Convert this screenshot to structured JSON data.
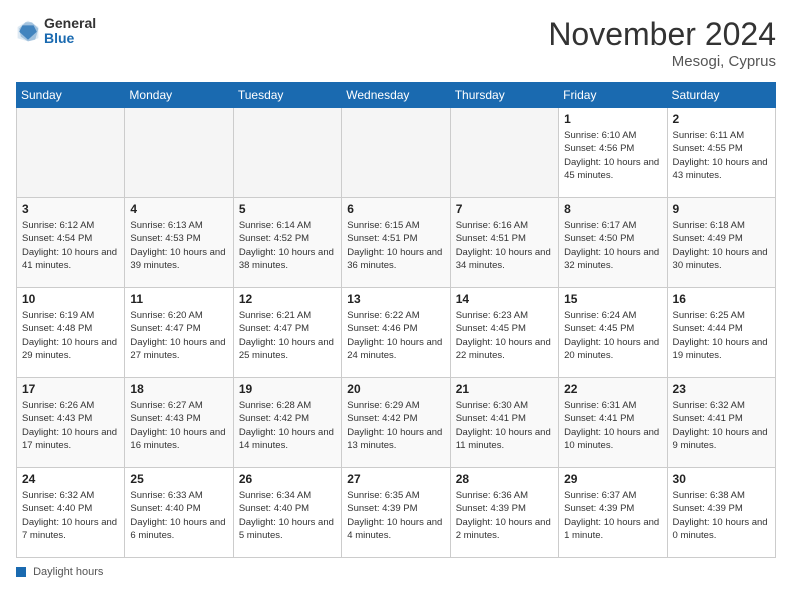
{
  "header": {
    "logo_general": "General",
    "logo_blue": "Blue",
    "month_title": "November 2024",
    "location": "Mesogi, Cyprus"
  },
  "columns": [
    "Sunday",
    "Monday",
    "Tuesday",
    "Wednesday",
    "Thursday",
    "Friday",
    "Saturday"
  ],
  "weeks": [
    [
      {
        "day": "",
        "info": ""
      },
      {
        "day": "",
        "info": ""
      },
      {
        "day": "",
        "info": ""
      },
      {
        "day": "",
        "info": ""
      },
      {
        "day": "",
        "info": ""
      },
      {
        "day": "1",
        "info": "Sunrise: 6:10 AM\nSunset: 4:56 PM\nDaylight: 10 hours and 45 minutes."
      },
      {
        "day": "2",
        "info": "Sunrise: 6:11 AM\nSunset: 4:55 PM\nDaylight: 10 hours and 43 minutes."
      }
    ],
    [
      {
        "day": "3",
        "info": "Sunrise: 6:12 AM\nSunset: 4:54 PM\nDaylight: 10 hours and 41 minutes."
      },
      {
        "day": "4",
        "info": "Sunrise: 6:13 AM\nSunset: 4:53 PM\nDaylight: 10 hours and 39 minutes."
      },
      {
        "day": "5",
        "info": "Sunrise: 6:14 AM\nSunset: 4:52 PM\nDaylight: 10 hours and 38 minutes."
      },
      {
        "day": "6",
        "info": "Sunrise: 6:15 AM\nSunset: 4:51 PM\nDaylight: 10 hours and 36 minutes."
      },
      {
        "day": "7",
        "info": "Sunrise: 6:16 AM\nSunset: 4:51 PM\nDaylight: 10 hours and 34 minutes."
      },
      {
        "day": "8",
        "info": "Sunrise: 6:17 AM\nSunset: 4:50 PM\nDaylight: 10 hours and 32 minutes."
      },
      {
        "day": "9",
        "info": "Sunrise: 6:18 AM\nSunset: 4:49 PM\nDaylight: 10 hours and 30 minutes."
      }
    ],
    [
      {
        "day": "10",
        "info": "Sunrise: 6:19 AM\nSunset: 4:48 PM\nDaylight: 10 hours and 29 minutes."
      },
      {
        "day": "11",
        "info": "Sunrise: 6:20 AM\nSunset: 4:47 PM\nDaylight: 10 hours and 27 minutes."
      },
      {
        "day": "12",
        "info": "Sunrise: 6:21 AM\nSunset: 4:47 PM\nDaylight: 10 hours and 25 minutes."
      },
      {
        "day": "13",
        "info": "Sunrise: 6:22 AM\nSunset: 4:46 PM\nDaylight: 10 hours and 24 minutes."
      },
      {
        "day": "14",
        "info": "Sunrise: 6:23 AM\nSunset: 4:45 PM\nDaylight: 10 hours and 22 minutes."
      },
      {
        "day": "15",
        "info": "Sunrise: 6:24 AM\nSunset: 4:45 PM\nDaylight: 10 hours and 20 minutes."
      },
      {
        "day": "16",
        "info": "Sunrise: 6:25 AM\nSunset: 4:44 PM\nDaylight: 10 hours and 19 minutes."
      }
    ],
    [
      {
        "day": "17",
        "info": "Sunrise: 6:26 AM\nSunset: 4:43 PM\nDaylight: 10 hours and 17 minutes."
      },
      {
        "day": "18",
        "info": "Sunrise: 6:27 AM\nSunset: 4:43 PM\nDaylight: 10 hours and 16 minutes."
      },
      {
        "day": "19",
        "info": "Sunrise: 6:28 AM\nSunset: 4:42 PM\nDaylight: 10 hours and 14 minutes."
      },
      {
        "day": "20",
        "info": "Sunrise: 6:29 AM\nSunset: 4:42 PM\nDaylight: 10 hours and 13 minutes."
      },
      {
        "day": "21",
        "info": "Sunrise: 6:30 AM\nSunset: 4:41 PM\nDaylight: 10 hours and 11 minutes."
      },
      {
        "day": "22",
        "info": "Sunrise: 6:31 AM\nSunset: 4:41 PM\nDaylight: 10 hours and 10 minutes."
      },
      {
        "day": "23",
        "info": "Sunrise: 6:32 AM\nSunset: 4:41 PM\nDaylight: 10 hours and 9 minutes."
      }
    ],
    [
      {
        "day": "24",
        "info": "Sunrise: 6:32 AM\nSunset: 4:40 PM\nDaylight: 10 hours and 7 minutes."
      },
      {
        "day": "25",
        "info": "Sunrise: 6:33 AM\nSunset: 4:40 PM\nDaylight: 10 hours and 6 minutes."
      },
      {
        "day": "26",
        "info": "Sunrise: 6:34 AM\nSunset: 4:40 PM\nDaylight: 10 hours and 5 minutes."
      },
      {
        "day": "27",
        "info": "Sunrise: 6:35 AM\nSunset: 4:39 PM\nDaylight: 10 hours and 4 minutes."
      },
      {
        "day": "28",
        "info": "Sunrise: 6:36 AM\nSunset: 4:39 PM\nDaylight: 10 hours and 2 minutes."
      },
      {
        "day": "29",
        "info": "Sunrise: 6:37 AM\nSunset: 4:39 PM\nDaylight: 10 hours and 1 minute."
      },
      {
        "day": "30",
        "info": "Sunrise: 6:38 AM\nSunset: 4:39 PM\nDaylight: 10 hours and 0 minutes."
      }
    ]
  ],
  "footer": {
    "label": "Daylight hours"
  }
}
